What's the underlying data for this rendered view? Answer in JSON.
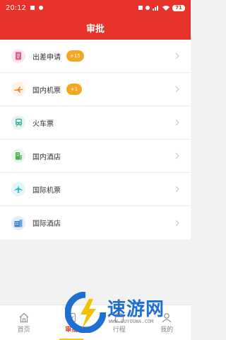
{
  "status_bar": {
    "time": "20:12",
    "battery": "71"
  },
  "header": {
    "title": "审批"
  },
  "items": [
    {
      "label": "出差申请",
      "badge": "+15",
      "icon": "document-icon",
      "icon_color": "#e85a8a",
      "icon_bg": "#fde8ef"
    },
    {
      "label": "国内机票",
      "badge": "+1",
      "icon": "airplane-icon",
      "icon_color": "#f08a2c",
      "icon_bg": "#fff1e3"
    },
    {
      "label": "火车票",
      "badge": "",
      "icon": "train-icon",
      "icon_color": "#3bb59d",
      "icon_bg": "#e4f6f1"
    },
    {
      "label": "国内酒店",
      "badge": "",
      "icon": "building-icon",
      "icon_color": "#4caf50",
      "icon_bg": "#e9f6ea"
    },
    {
      "label": "国际机票",
      "badge": "",
      "icon": "airplane-icon",
      "icon_color": "#36b5c5",
      "icon_bg": "#e3f6f8"
    },
    {
      "label": "国际酒店",
      "badge": "",
      "icon": "hotel-icon",
      "icon_color": "#3b82c8",
      "icon_bg": "#e4eef9"
    }
  ],
  "tabbar": {
    "tabs": [
      {
        "label": "首页",
        "active": false
      },
      {
        "label": "审批",
        "active": true
      },
      {
        "label": "行程",
        "active": false
      },
      {
        "label": "我的",
        "active": false
      }
    ]
  },
  "watermark": {
    "text": "速游网",
    "url": "WWW.SUYOUWA.COM"
  },
  "colors": {
    "primary": "#e8332c",
    "badge": "#f5a623",
    "indicator": "#f5c518"
  }
}
